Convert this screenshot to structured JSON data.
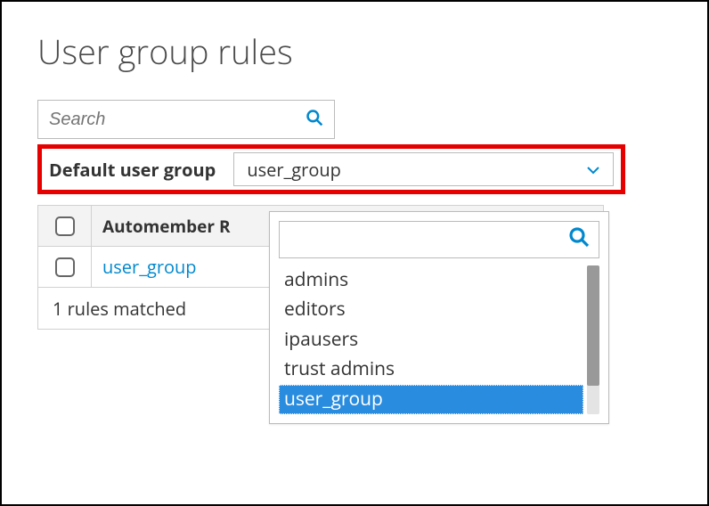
{
  "title": "User group rules",
  "search": {
    "placeholder": "Search"
  },
  "default_group": {
    "label": "Default user group",
    "selected": "user_group"
  },
  "table": {
    "header_col": "Automember R",
    "rows": [
      {
        "name": "user_group"
      }
    ],
    "footer": "1 rules matched"
  },
  "dropdown": {
    "search_placeholder": "",
    "options": [
      "admins",
      "editors",
      "ipausers",
      "trust admins",
      "user_group"
    ],
    "selected_index": 4
  }
}
